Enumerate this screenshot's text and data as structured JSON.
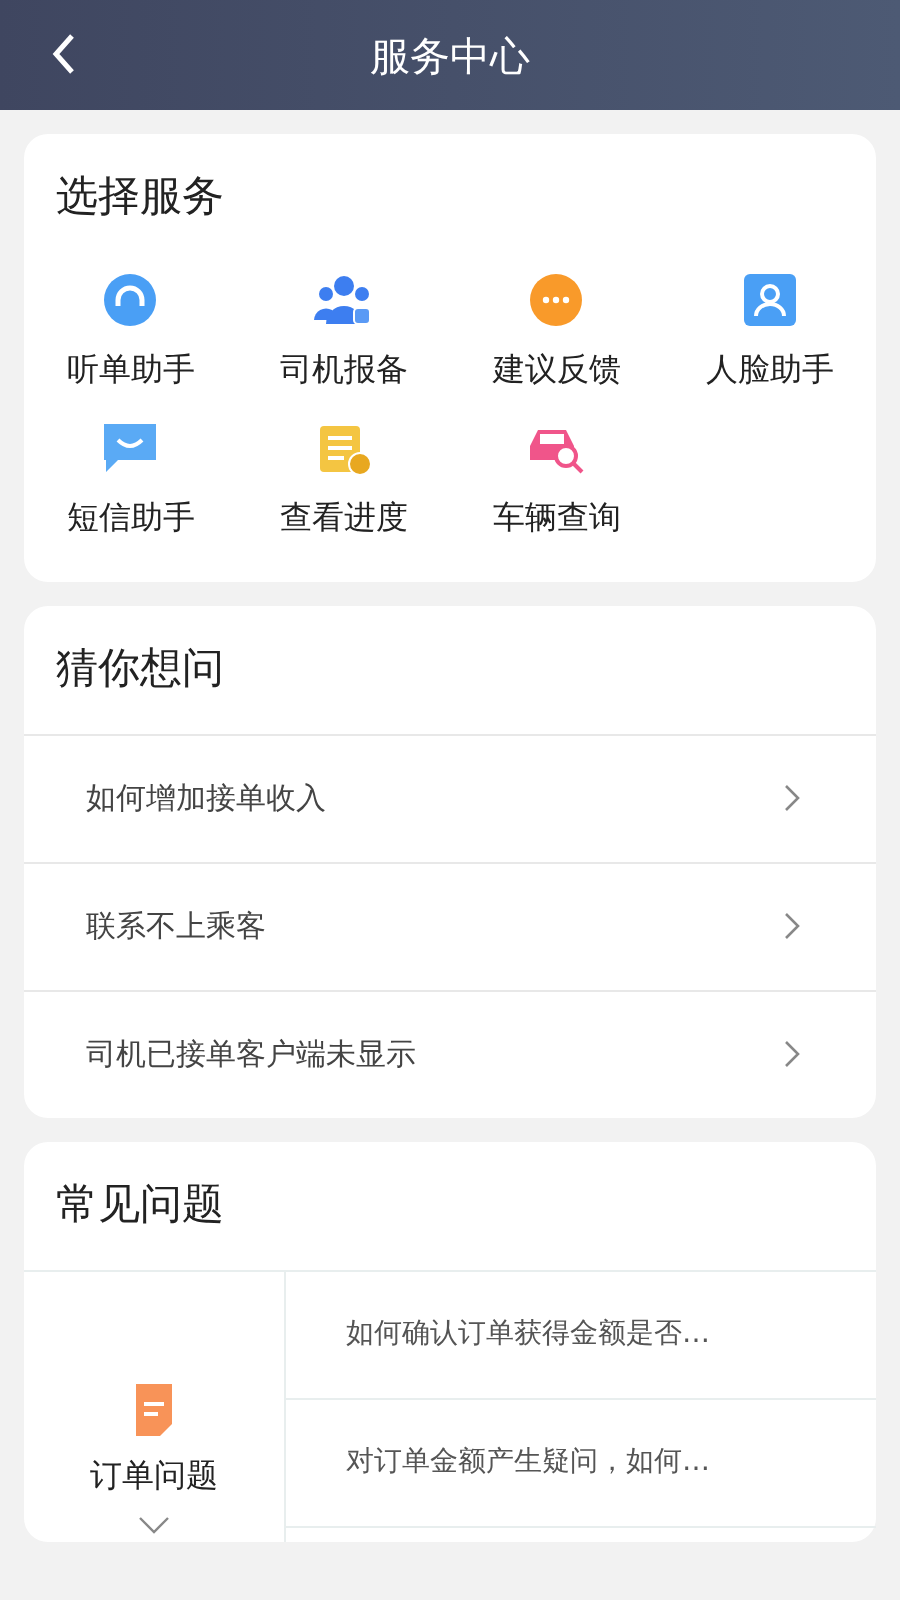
{
  "header": {
    "title": "服务中心"
  },
  "services": {
    "title": "选择服务",
    "items": [
      {
        "label": "听单助手",
        "kind": "headset"
      },
      {
        "label": "司机报备",
        "kind": "people"
      },
      {
        "label": "建议反馈",
        "kind": "dots"
      },
      {
        "label": "人脸助手",
        "kind": "face"
      },
      {
        "label": "短信助手",
        "kind": "message"
      },
      {
        "label": "查看进度",
        "kind": "progress"
      },
      {
        "label": "车辆查询",
        "kind": "car"
      }
    ]
  },
  "guess": {
    "title": "猜你想问",
    "items": [
      "如何增加接单收入",
      "联系不上乘客",
      "司机已接单客户端未显示"
    ]
  },
  "faq": {
    "title": "常见问题",
    "category": {
      "label": "订单问题",
      "expanded": false
    },
    "questions": [
      "如何确认订单获得金额是否…",
      "对订单金额产生疑问，如何…"
    ]
  }
}
